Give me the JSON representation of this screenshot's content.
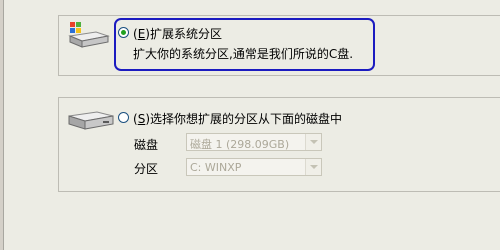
{
  "option_extend_system": {
    "hotkey": "E",
    "label": "扩展系统分区",
    "description": "扩大你的系统分区,通常是我们所说的C盘.",
    "selected": true
  },
  "option_choose_partition": {
    "hotkey": "S",
    "label": "选择你想扩展的分区从下面的磁盘中",
    "selected": false
  },
  "disk_field": {
    "label": "磁盘",
    "value": "磁盘 1 (298.09GB)"
  },
  "partition_field": {
    "label": "分区",
    "value": "C: WINXP"
  },
  "colors": {
    "focus_border": "#1b1bc0",
    "radio_dot": "#21a121",
    "background": "#ecece4"
  }
}
